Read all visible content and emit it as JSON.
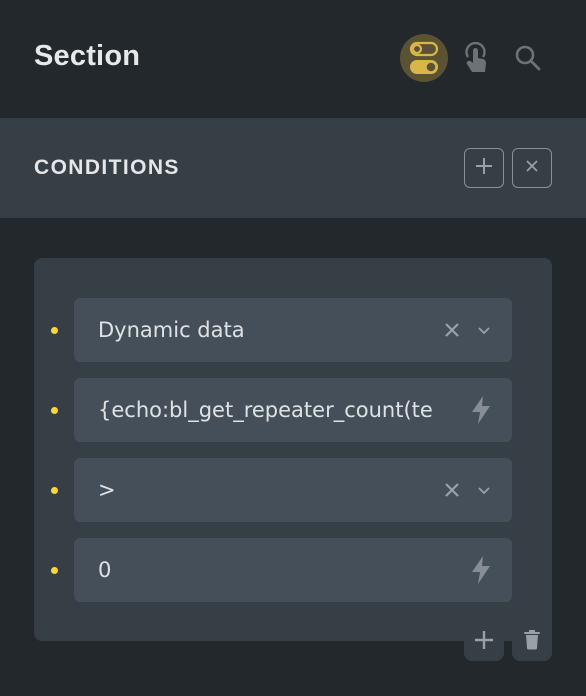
{
  "header": {
    "title": "Section",
    "icons": [
      {
        "name": "toggle-conditions-icon",
        "active": true
      },
      {
        "name": "interactions-icon",
        "active": false
      },
      {
        "name": "search-icon",
        "active": false
      }
    ]
  },
  "conditions": {
    "title": "CONDITIONS",
    "add_label": "add",
    "close_label": "close"
  },
  "condition_group": {
    "rows": [
      {
        "value": "Dynamic data",
        "type": "select",
        "has_clear": true
      },
      {
        "value": "{echo:bl_get_repeater_count(te",
        "type": "dynamic-input"
      },
      {
        "value": ">",
        "type": "select",
        "has_clear": true
      },
      {
        "value": "0",
        "type": "dynamic-input"
      }
    ],
    "actions": [
      "add-condition",
      "delete-group"
    ]
  },
  "colors": {
    "accent": "#ffd53e",
    "active_icon_bg": "#5b5233",
    "active_icon_fg": "#d9b64a",
    "panel_bg": "#23282d",
    "bar_bg": "#363e46",
    "field_bg": "#454f59"
  }
}
